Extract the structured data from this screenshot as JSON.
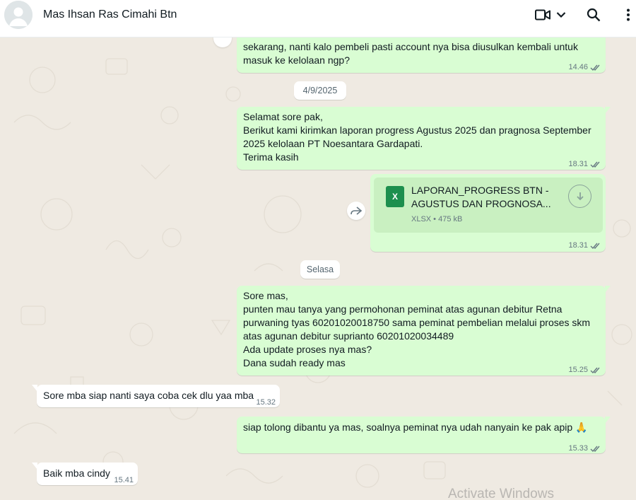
{
  "header": {
    "contact_name": "Mas Ihsan Ras Cimahi Btn"
  },
  "icons": {
    "avatar": "default-avatar-icon",
    "video": "video-call-icon",
    "dropdown": "chevron-down-icon",
    "search": "search-icon",
    "menu": "more-vert-icon",
    "forward": "forward-icon",
    "download": "download-icon",
    "file": "xlsx-file-icon",
    "ticks": "double-check-icon"
  },
  "colors": {
    "outgoing_bubble": "#d9fdd3",
    "incoming_bubble": "#ffffff",
    "chat_background": "#efeae2",
    "read_ticks": "#667781"
  },
  "messages": [
    {
      "type": "out",
      "text": "sekarang, nanti kalo pembeli pasti account nya bisa diusulkan kembali untuk\nmasuk ke kelolaan ngp?",
      "time": "14.46"
    },
    {
      "type": "date",
      "text": "4/9/2025"
    },
    {
      "type": "out",
      "text": "Selamat sore pak,\nBerikut kami kirimkan laporan progress Agustus 2025 dan pragnosa September\n2025 kelolaan PT Noesantara Gardapati.\nTerima kasih",
      "time": "18.31"
    },
    {
      "type": "out-doc",
      "file_name": "LAPORAN_PROGRESS BTN - AGUSTUS DAN PROGNOSA...",
      "file_badge": "X",
      "file_info": "XLSX • 475 kB",
      "time": "18.31"
    },
    {
      "type": "date",
      "text": "Selasa"
    },
    {
      "type": "out",
      "text": "Sore mas,\npunten mau tanya yang permohonan peminat atas agunan debitur Retna\npurwaning tyas 60201020018750 sama peminat pembelian melalui proses skm\natas agunan debitur suprianto 60201020034489\nAda update proses nya mas?\nDana sudah ready mas",
      "time": "15.25"
    },
    {
      "type": "in",
      "text": "Sore mba siap nanti saya coba cek dlu yaa mba",
      "time": "15.32"
    },
    {
      "type": "out",
      "text": "siap tolong dibantu ya mas, soalnya peminat nya udah nanyain ke pak apip 🙏",
      "time": "15.33"
    },
    {
      "type": "in",
      "text": "Baik mba cindy",
      "time": "15.41"
    }
  ],
  "watermark": "Activate Windows"
}
